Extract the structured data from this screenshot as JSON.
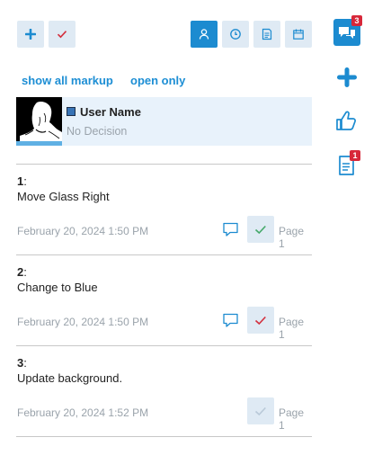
{
  "colors": {
    "accent": "#1c8bd0",
    "button_bg": "#dfeaf4",
    "badge": "#d7283a",
    "check_red": "#d32f3d",
    "check_green": "#46a96b"
  },
  "links": {
    "show_all": "show all markup",
    "open_only": "open only"
  },
  "user": {
    "name": "User Name",
    "status": "No Decision",
    "swatch_color": "#3874b6"
  },
  "items": [
    {
      "number": "1",
      "sep": ":",
      "title": "Move Glass Right",
      "date": "February 20, 2024 1:50 PM",
      "page": "Page 1",
      "has_comment": true,
      "check_state": "green"
    },
    {
      "number": "2",
      "sep": ":",
      "title": "Change to Blue",
      "date": "February 20, 2024 1:50 PM",
      "page": "Page 1",
      "has_comment": true,
      "check_state": "red"
    },
    {
      "number": "3",
      "sep": ":",
      "title": "Update background.",
      "date": "February 20, 2024 1:52 PM",
      "page": "Page 1",
      "has_comment": false,
      "check_state": "pending"
    }
  ],
  "rail": {
    "comments_badge": "3",
    "markup_badge": "1"
  }
}
